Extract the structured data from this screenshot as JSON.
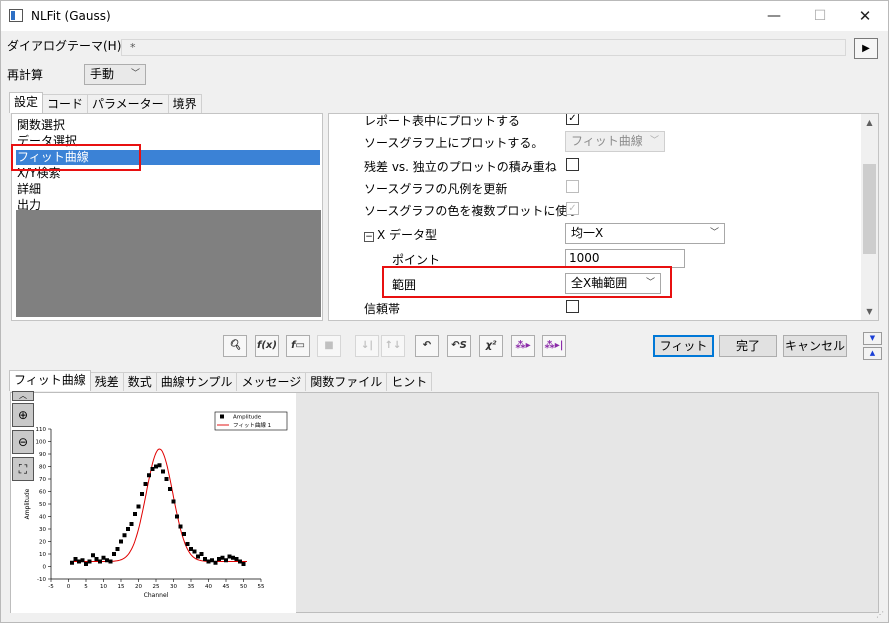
{
  "window": {
    "title": "NLFit (Gauss)"
  },
  "dialog_theme": {
    "label": "ダイアログテーマ(H)",
    "value": "*"
  },
  "recalc": {
    "label": "再計算",
    "value": "手動"
  },
  "top_tabs": [
    "設定",
    "コード",
    "パラメーター",
    "境界"
  ],
  "settings_list": [
    "関数選択",
    "データ選択",
    "フィット曲線",
    "X/Y検索",
    "詳細",
    "出力"
  ],
  "properties": {
    "row0_label": "レポート表中にプロットする",
    "plot_on_source_label": "ソースグラフ上にプロットする。",
    "plot_on_source_value": "フィット曲線",
    "stack_residual_label": "残差 vs. 独立のプロットの積み重ね",
    "update_legend_label": "ソースグラフの凡例を更新",
    "multi_color_label": "ソースグラフの色を複数プロットに使う",
    "x_data_type_label": "X データ型",
    "x_data_type_value": "均一X",
    "points_label": "ポイント",
    "points_value": "1000",
    "range_label": "範囲",
    "range_value": "全X軸範囲",
    "confidence_label": "信頼帯"
  },
  "buttons": {
    "fit": "フィット",
    "done": "完了",
    "cancel": "キャンセル"
  },
  "bottom_tabs": [
    "フィット曲線",
    "残差",
    "数式",
    "曲線サンプル",
    "メッセージ",
    "関数ファイル",
    "ヒント"
  ],
  "chart_data": {
    "type": "scatter",
    "xlabel": "Channel",
    "ylabel": "Amplitude",
    "xlim": [
      -5,
      55
    ],
    "ylim": [
      -10,
      110
    ],
    "x_ticks": [
      -5,
      0,
      5,
      10,
      15,
      20,
      25,
      30,
      35,
      40,
      45,
      50,
      55
    ],
    "y_ticks": [
      -10,
      0,
      10,
      20,
      30,
      40,
      50,
      60,
      70,
      80,
      90,
      100,
      110
    ],
    "series": [
      {
        "name": "Amplitude",
        "kind": "scatter",
        "color": "#000000",
        "x": [
          1,
          2,
          3,
          4,
          5,
          6,
          7,
          8,
          9,
          10,
          11,
          12,
          13,
          14,
          15,
          16,
          17,
          18,
          19,
          20,
          21,
          22,
          23,
          24,
          25,
          26,
          27,
          28,
          29,
          30,
          31,
          32,
          33,
          34,
          35,
          36,
          37,
          38,
          39,
          40,
          41,
          42,
          43,
          44,
          45,
          46,
          47,
          48,
          49,
          50
        ],
        "y": [
          3,
          6,
          4,
          5,
          2,
          4,
          9,
          6,
          4,
          7,
          5,
          4,
          10,
          14,
          20,
          25,
          30,
          34,
          42,
          48,
          58,
          66,
          73,
          78,
          80,
          81,
          76,
          70,
          62,
          52,
          40,
          32,
          26,
          18,
          14,
          12,
          8,
          10,
          6,
          4,
          5,
          3,
          6,
          7,
          5,
          8,
          7,
          6,
          4,
          2
        ]
      },
      {
        "name": "フィット曲線 1",
        "kind": "line",
        "color": "#e00000",
        "gauss": {
          "y0": 4,
          "xc": 26,
          "w": 7.6,
          "A": 90
        }
      }
    ],
    "legend": "top-right"
  },
  "colors": {
    "accent": "#0078d7",
    "highlight_red": "#e81010",
    "selection": "#3b82d6",
    "fit_line": "#e00000"
  }
}
